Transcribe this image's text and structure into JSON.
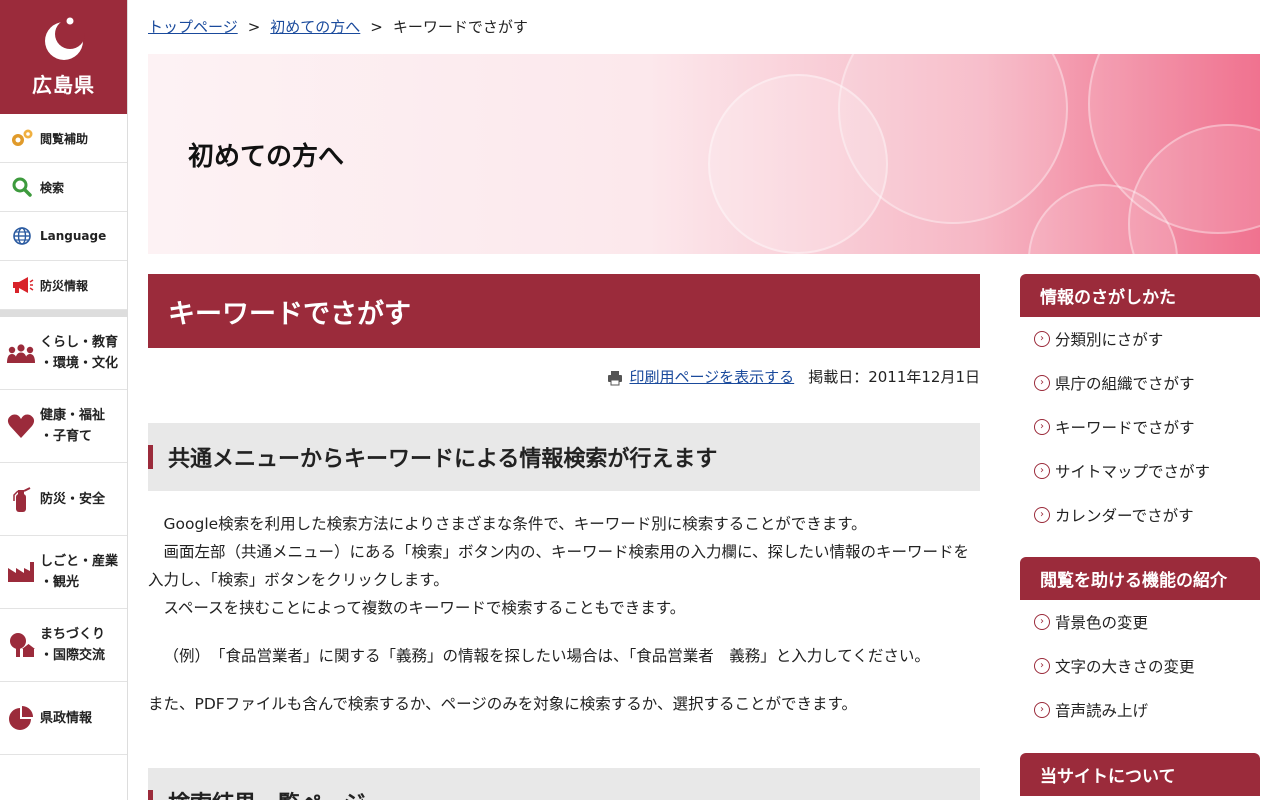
{
  "site": {
    "name": "広島県"
  },
  "tools": [
    {
      "label": "閲覧補助"
    },
    {
      "label": "検索"
    },
    {
      "label": "Language"
    },
    {
      "label": "防災情報"
    }
  ],
  "categories": [
    {
      "line1": "くらし・教育",
      "line2": "・環境・文化"
    },
    {
      "line1": "健康・福祉",
      "line2": "・子育て"
    },
    {
      "line1": "防災・安全",
      "line2": ""
    },
    {
      "line1": "しごと・産業",
      "line2": "・観光"
    },
    {
      "line1": "まちづくり",
      "line2": "・国際交流"
    },
    {
      "line1": "県政情報",
      "line2": ""
    }
  ],
  "breadcrumb": {
    "home": "トップページ",
    "parent": "初めての方へ",
    "current": "キーワードでさがす",
    "separator": ">"
  },
  "hero": {
    "title": "初めての方へ"
  },
  "main": {
    "title": "キーワードでさがす",
    "print_link": "印刷用ページを表示する",
    "published": "掲載日：2011年12月1日",
    "section1_heading": "共通メニューからキーワードによる情報検索が行えます",
    "para1": "Google検索を利用した検索方法によりさまざまな条件で、キーワード別に検索することができます。",
    "para2": "画面左部（共通メニュー）にある「検索」ボタン内の、キーワード検索用の入力欄に、探したい情報のキーワードを入力し、「検索」ボタンをクリックします。",
    "para3": "スペースを挟むことによって複数のキーワードで検索することもできます。",
    "para4": "（例）　「食品営業者」に関する「義務」の情報を探したい場合は、「食品営業者　義務」と入力してください。",
    "para5": "また、PDFファイルも含んで検索するか、ページのみを対象に検索するか、選択することができます。",
    "section2_heading": "検索結果一覧ページ"
  },
  "right": {
    "box1": {
      "title": "情報のさがしかた",
      "items": [
        "分類別にさがす",
        "県庁の組織でさがす",
        "キーワードでさがす",
        "サイトマップでさがす",
        "カレンダーでさがす"
      ]
    },
    "box2": {
      "title": "閲覧を助ける機能の紹介",
      "items": [
        "背景色の変更",
        "文字の大きさの変更",
        "音声読み上げ"
      ]
    },
    "box3": {
      "title": "当サイトについて"
    }
  },
  "colors": {
    "brand": "#9b2b3b",
    "link": "#1a4a9c"
  }
}
